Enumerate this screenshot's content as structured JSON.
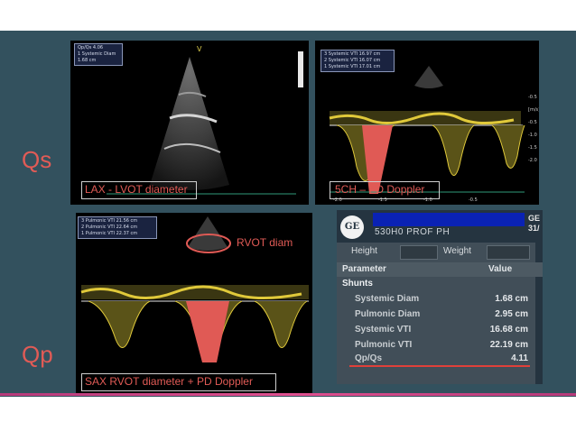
{
  "labels": {
    "qs": "Qs",
    "qp": "Qp"
  },
  "panel_lax": {
    "measurements": [
      "Qp/Qs                  4.06",
      "1  Systemic Diam     1.68 cm"
    ],
    "caption": "LAX - LVOT diameter"
  },
  "panel_5ch": {
    "measurements": [
      "3  Systemic VTI   16.97 cm",
      "2  Systemic VTI   16.07 cm",
      "1  Systemic VTI   17.01 cm"
    ],
    "caption": "5CH – PD Doppler",
    "scale_ticks": [
      "-0.5",
      "[m/s]",
      "-0.5",
      "-1.0",
      "-1.5",
      "-2.0"
    ],
    "time_ticks": [
      "-2.0",
      "-1.5",
      "-1.0",
      "-0.5"
    ]
  },
  "panel_sax": {
    "measurements": [
      "3  Pulmonic VTI   21.56 cm",
      "2  Pulmonic VTI   22.64 cm",
      "1  Pulmonic VTI   22.37 cm"
    ],
    "annotation": "RVOT diam",
    "caption": "SAX RVOT diameter + PD Doppler"
  },
  "ge_report": {
    "logo": "GE",
    "patient": "530H0 PROF PH",
    "corner": [
      "GE",
      "31/"
    ],
    "height_label": "Height",
    "weight_label": "Weight",
    "col_parameter": "Parameter",
    "col_value": "Value",
    "section": "Shunts",
    "rows": [
      {
        "label": "Systemic Diam",
        "value": "1.68 cm"
      },
      {
        "label": "Pulmonic Diam",
        "value": "2.95 cm"
      },
      {
        "label": "Systemic VTI",
        "value": "16.68 cm"
      },
      {
        "label": "Pulmonic VTI",
        "value": "22.19 cm"
      },
      {
        "label": "Qp/Qs",
        "value": "4.11"
      }
    ]
  },
  "colors": {
    "slide_bg": "#33515e",
    "accent_red": "#e15b56",
    "doppler_yellow": "#e0c93a"
  }
}
